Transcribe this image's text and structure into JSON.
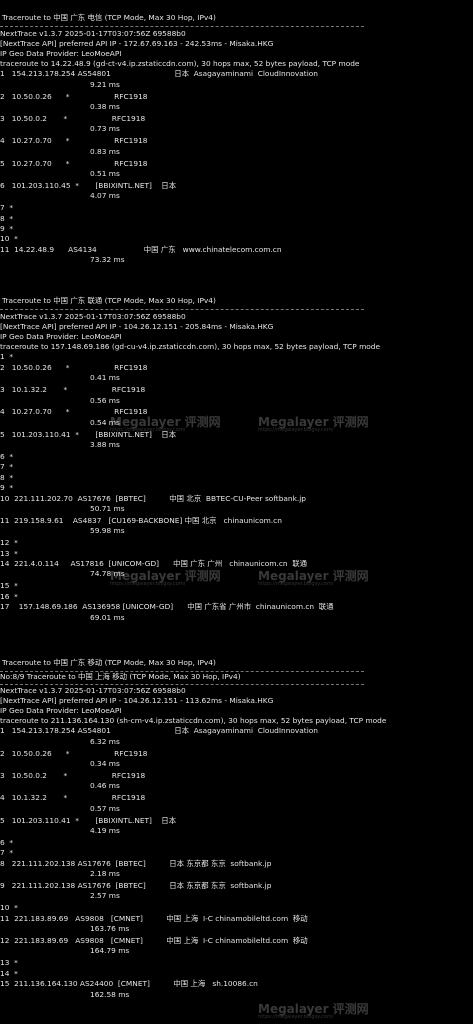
{
  "sections": [
    {
      "title": "Traceroute to 中国 广东 电信 (TCP Mode, Max 30 Hop, IPv4)",
      "sub": "",
      "header": [
        "NextTrace v1.3.7 2025-01-17T03:07:56Z 69588b0",
        "[NextTrace API] preferred API IP - 172.67.69.163 - 242.53ms - Misaka.HKG",
        "IP Geo Data Provider: LeoMoeAPI",
        "traceroute to 14.22.48.9 (gd-ct-v4.ip.zstaticcdn.com), 30 hops max, 52 bytes payload, TCP mode"
      ],
      "hops": [
        {
          "line": "1   154.213.178.254 AS54801                           日本  Asagayaminami  CloudInnovation",
          "ms": "9.21 ms"
        },
        {
          "line": "2   10.50.0.26      *                   RFC1918",
          "ms": "0.38 ms"
        },
        {
          "line": "3   10.50.0.2       *                   RFC1918",
          "ms": "0.73 ms"
        },
        {
          "line": "4   10.27.0.70      *                   RFC1918",
          "ms": "0.83 ms"
        },
        {
          "line": "5   10.27.0.70      *                   RFC1918",
          "ms": "0.51 ms"
        },
        {
          "line": "6   101.203.110.45  *       [BBIXINTL.NET]    日本",
          "ms": "4.07 ms"
        },
        {
          "line": "7  *",
          "ms": ""
        },
        {
          "line": "8  *",
          "ms": ""
        },
        {
          "line": "9  *",
          "ms": ""
        },
        {
          "line": "10  *",
          "ms": ""
        },
        {
          "line": "11  14.22.48.9      AS4134                    中国 广东   www.chinatelecom.com.cn",
          "ms": "73.32 ms"
        }
      ]
    },
    {
      "title": "Traceroute to 中国 广东 联通 (TCP Mode, Max 30 Hop, IPv4)",
      "sub": "",
      "header": [
        "NextTrace v1.3.7 2025-01-17T03:07:56Z 69588b0",
        "[NextTrace API] preferred API IP - 104.26.12.151 - 205.84ms - Misaka.HKG",
        "IP Geo Data Provider: LeoMoeAPI",
        "traceroute to 157.148.69.186 (gd-cu-v4.ip.zstaticcdn.com), 30 hops max, 52 bytes payload, TCP mode"
      ],
      "hops": [
        {
          "line": "1  *",
          "ms": ""
        },
        {
          "line": "2   10.50.0.26      *                   RFC1918",
          "ms": "0.41 ms"
        },
        {
          "line": "3   10.1.32.2       *                   RFC1918",
          "ms": "0.56 ms"
        },
        {
          "line": "4   10.27.0.70      *                   RFC1918",
          "ms": "0.54 ms"
        },
        {
          "line": "5   101.203.110.41  *       [BBIXINTL.NET]    日本",
          "ms": "3.88 ms"
        },
        {
          "line": "6  *",
          "ms": ""
        },
        {
          "line": "7  *",
          "ms": ""
        },
        {
          "line": "8  *",
          "ms": ""
        },
        {
          "line": "9  *",
          "ms": ""
        },
        {
          "line": "10  221.111.202.70  AS17676  [BBTEC]          中国 北京  BBTEC-CU-Peer softbank.jp",
          "ms": "50.71 ms"
        },
        {
          "line": "11  219.158.9.61    AS4837   [CU169-BACKBONE] 中国 北京   chinaunicom.cn",
          "ms": "59.98 ms"
        },
        {
          "line": "12  *",
          "ms": ""
        },
        {
          "line": "13  *",
          "ms": ""
        },
        {
          "line": "14  221.4.0.114     AS17816  [UNICOM-GD]      中国 广东 广州   chinaunicom.cn  联通",
          "ms": "74.78 ms"
        },
        {
          "line": "15  *",
          "ms": ""
        },
        {
          "line": "16  *",
          "ms": ""
        },
        {
          "line": "17    157.148.69.186  AS136958 [UNICOM-GD]      中国 广东省 广州市  chinaunicom.cn  联通",
          "ms": "69.01 ms"
        }
      ]
    },
    {
      "title": "Traceroute to 中国 广东 移动 (TCP Mode, Max 30 Hop, IPv4)",
      "sub": "No:8/9 Traceroute to 中国 上海 移动 (TCP Mode, Max 30 Hop, IPv4)",
      "header": [
        "NextTrace v1.3.7 2025-01-17T03:07:56Z 69588b0",
        "[NextTrace API] preferred API IP - 104.26.12.151 - 113.62ms - Misaka.HKG",
        "IP Geo Data Provider: LeoMoeAPI",
        "traceroute to 211.136.164.130 (sh-cm-v4.ip.zstaticcdn.com), 30 hops max, 52 bytes payload, TCP mode"
      ],
      "hops": [
        {
          "line": "1   154.213.178.254 AS54801                           日本  Asagayaminami  CloudInnovation",
          "ms": "6.32 ms"
        },
        {
          "line": "2   10.50.0.26      *                   RFC1918",
          "ms": "0.34 ms"
        },
        {
          "line": "3   10.50.0.2       *                   RFC1918",
          "ms": "0.46 ms"
        },
        {
          "line": "4   10.1.32.2       *                   RFC1918",
          "ms": "0.57 ms"
        },
        {
          "line": "5   101.203.110.41  *       [BBIXINTL.NET]    日本",
          "ms": "4.19 ms"
        },
        {
          "line": "6  *",
          "ms": ""
        },
        {
          "line": "7  *",
          "ms": ""
        },
        {
          "line": "8   221.111.202.138 AS17676  [BBTEC]          日本 东京都 东京  softbank.jp",
          "ms": "2.18 ms"
        },
        {
          "line": "9   221.111.202.138 AS17676  [BBTEC]          日本 东京都 东京  softbank.jp",
          "ms": "2.57 ms"
        },
        {
          "line": "10  *",
          "ms": ""
        },
        {
          "line": "11  221.183.89.69   AS9808   [CMNET]          中国 上海  I-C chinamobileltd.com  移动",
          "ms": "163.76 ms"
        },
        {
          "line": "12  221.183.89.69   AS9808   [CMNET]          中国 上海  I-C chinamobileltd.com  移动",
          "ms": "164.79 ms"
        },
        {
          "line": "13  *",
          "ms": ""
        },
        {
          "line": "14  *",
          "ms": ""
        },
        {
          "line": "15  211.136.164.130 AS24400  [CMNET]          中国 上海   sh.10086.cn",
          "ms": "162.58 ms"
        }
      ]
    }
  ],
  "watermark": {
    "name": "Megalayer 评测网",
    "url": "https://megalayer.blogsy.com/"
  }
}
